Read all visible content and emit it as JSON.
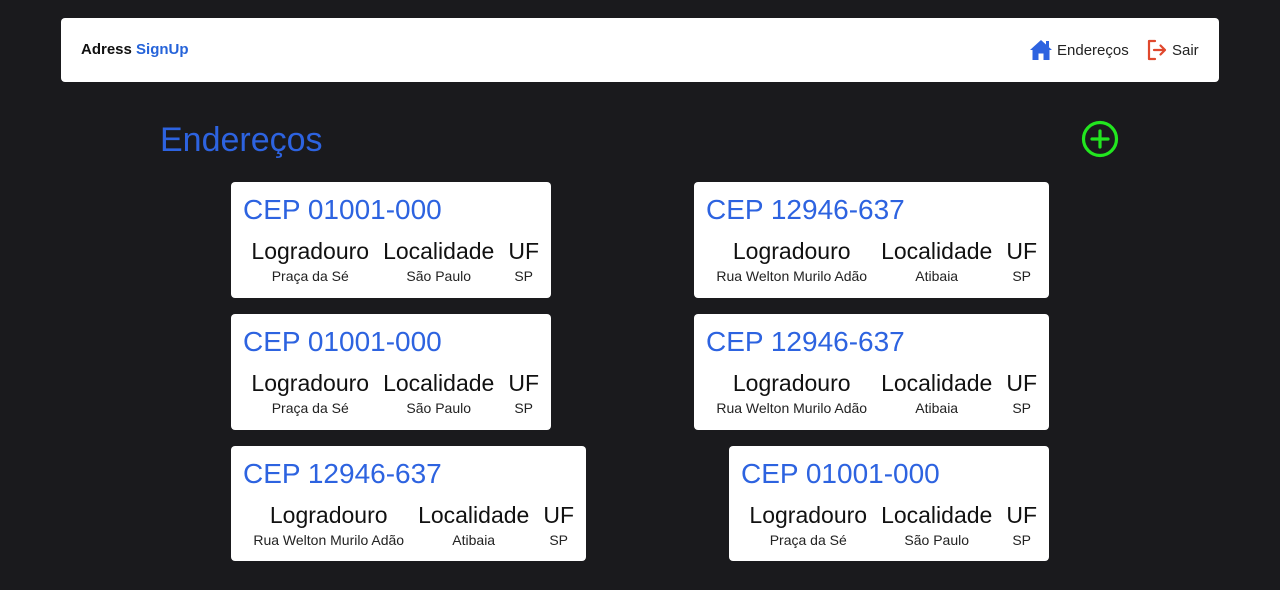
{
  "navbar": {
    "brand_part1": "Adress ",
    "brand_part2": "SignUp",
    "home_label": "Endereços",
    "exit_label": "Sair"
  },
  "page": {
    "title": "Endereços"
  },
  "labels": {
    "logradouro": "Logradouro",
    "localidade": "Localidade",
    "uf": "UF"
  },
  "cards": [
    {
      "cep": "CEP 01001-000",
      "logradouro": "Praça da Sé",
      "localidade": "São Paulo",
      "uf": "SP"
    },
    {
      "cep": "CEP 12946-637",
      "logradouro": "Rua Welton Murilo Adão",
      "localidade": "Atibaia",
      "uf": "SP"
    },
    {
      "cep": "CEP 01001-000",
      "logradouro": "Praça da Sé",
      "localidade": "São Paulo",
      "uf": "SP"
    },
    {
      "cep": "CEP 12946-637",
      "logradouro": "Rua Welton Murilo Adão",
      "localidade": "Atibaia",
      "uf": "SP"
    },
    {
      "cep": "CEP 12946-637",
      "logradouro": "Rua Welton Murilo Adão",
      "localidade": "Atibaia",
      "uf": "SP"
    },
    {
      "cep": "CEP 01001-000",
      "logradouro": "Praça da Sé",
      "localidade": "São Paulo",
      "uf": "SP"
    }
  ],
  "icons": {
    "home": "home-icon",
    "exit": "sign-out-icon",
    "add": "plus-circle-icon"
  },
  "colors": {
    "background": "#1a1a1d",
    "accent": "#2d63e0",
    "exit_icon": "#e0482d",
    "add_icon": "#22e61f"
  }
}
